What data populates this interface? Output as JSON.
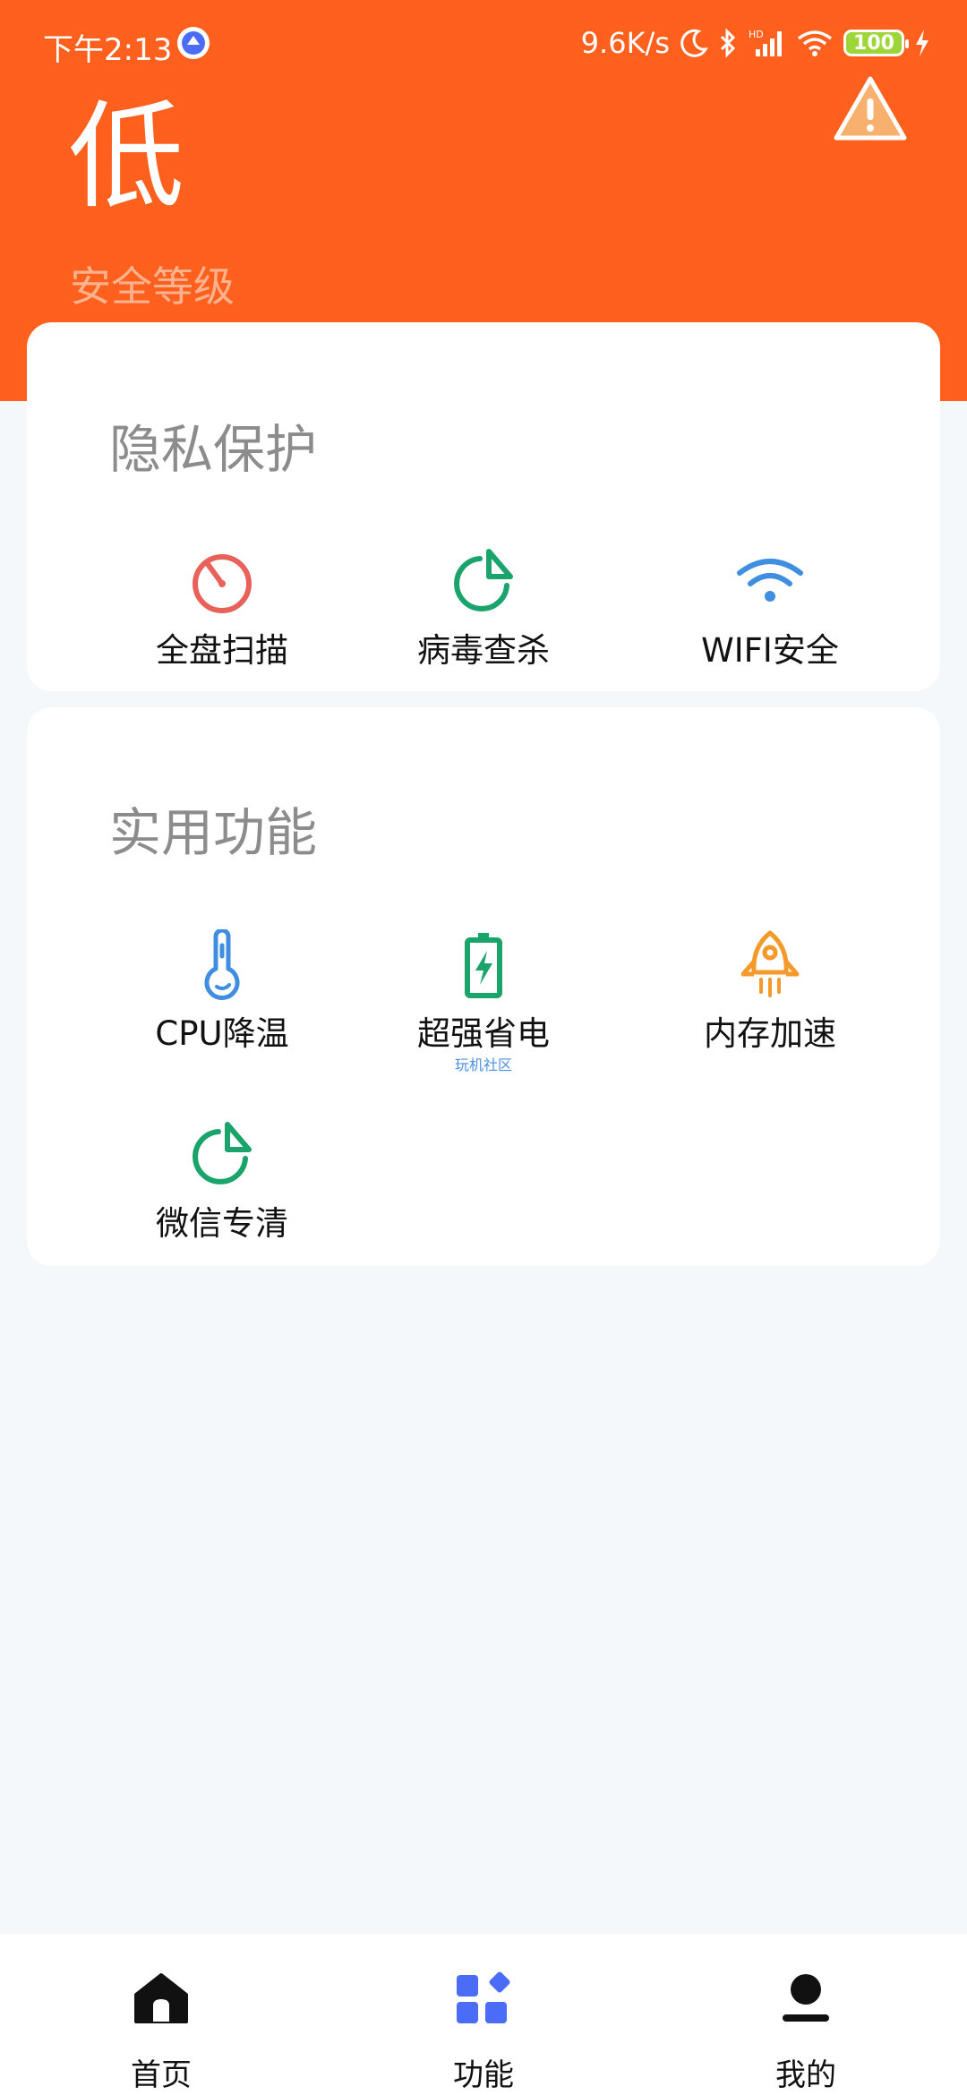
{
  "status_bar": {
    "time": "下午2:13",
    "net_speed": "9.6K/s",
    "battery": "100"
  },
  "header": {
    "level": "低",
    "level_label": "安全等级",
    "warning_icon": "warning-triangle-icon"
  },
  "privacy_section": {
    "title": "隐私保护",
    "items": [
      {
        "label": "全盘扫描",
        "icon": "scan-dial-icon",
        "color": "#e8625a"
      },
      {
        "label": "病毒查杀",
        "icon": "pie-chart-icon",
        "color": "#1aa36b"
      },
      {
        "label": "WIFI安全",
        "icon": "wifi-icon",
        "color": "#3f8ee0"
      }
    ]
  },
  "tools_section": {
    "title": "实用功能",
    "items": [
      {
        "label": "CPU降温",
        "icon": "thermometer-icon",
        "color": "#3f8ee0"
      },
      {
        "label": "超强省电",
        "icon": "battery-charge-icon",
        "color": "#1aa36b",
        "watermark": "玩机社区"
      },
      {
        "label": "内存加速",
        "icon": "rocket-icon",
        "color": "#f39a2a"
      },
      {
        "label": "微信专清",
        "icon": "pie-chart-icon",
        "color": "#1aa36b"
      }
    ]
  },
  "bottom_nav": {
    "items": [
      {
        "label": "首页",
        "icon": "home-icon",
        "color": "#111111"
      },
      {
        "label": "功能",
        "icon": "apps-grid-icon",
        "color": "#4a6cf7",
        "active": true
      },
      {
        "label": "我的",
        "icon": "profile-icon",
        "color": "#111111"
      }
    ]
  },
  "colors": {
    "header_bg": "#ff601e",
    "page_bg": "#f4f8fa",
    "level_label": "#fdb28e"
  }
}
